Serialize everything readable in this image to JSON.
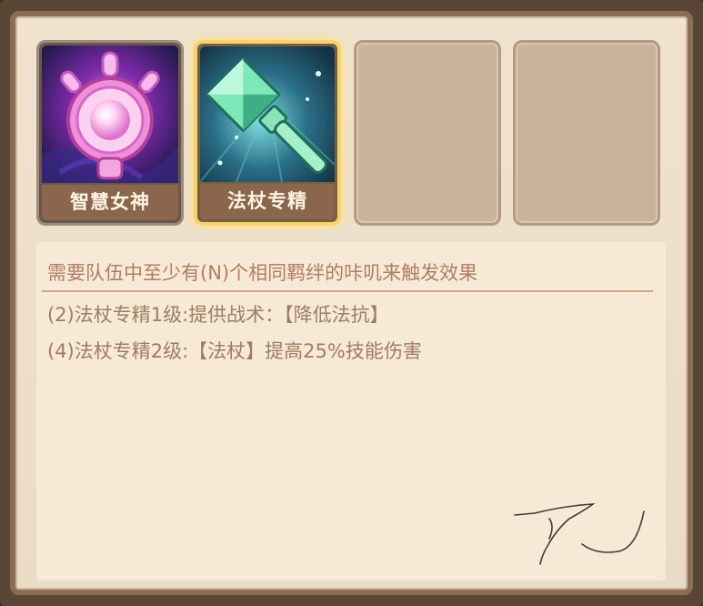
{
  "slots": [
    {
      "name": "智慧女神",
      "state": "filled",
      "icon": "goddess-of-wisdom-icon"
    },
    {
      "name": "法杖专精",
      "state": "selected",
      "icon": "staff-mastery-icon"
    },
    {
      "name": "",
      "state": "empty"
    },
    {
      "name": "",
      "state": "empty"
    }
  ],
  "description": {
    "header": "需要队伍中至少有(N)个相同羁绊的咔叽来触发效果",
    "tiers": [
      "(2)法杖专精1级:提供战术：【降低法抗】",
      "(4)法杖专精2级:【法杖】提高25%技能伤害"
    ]
  },
  "colors": {
    "panel_bg": "#efe3cf",
    "frame": "#8a6f55",
    "selected_glow": "#f7d36c",
    "name_bar": "#8a664c",
    "desc_text": "#a07b62"
  }
}
